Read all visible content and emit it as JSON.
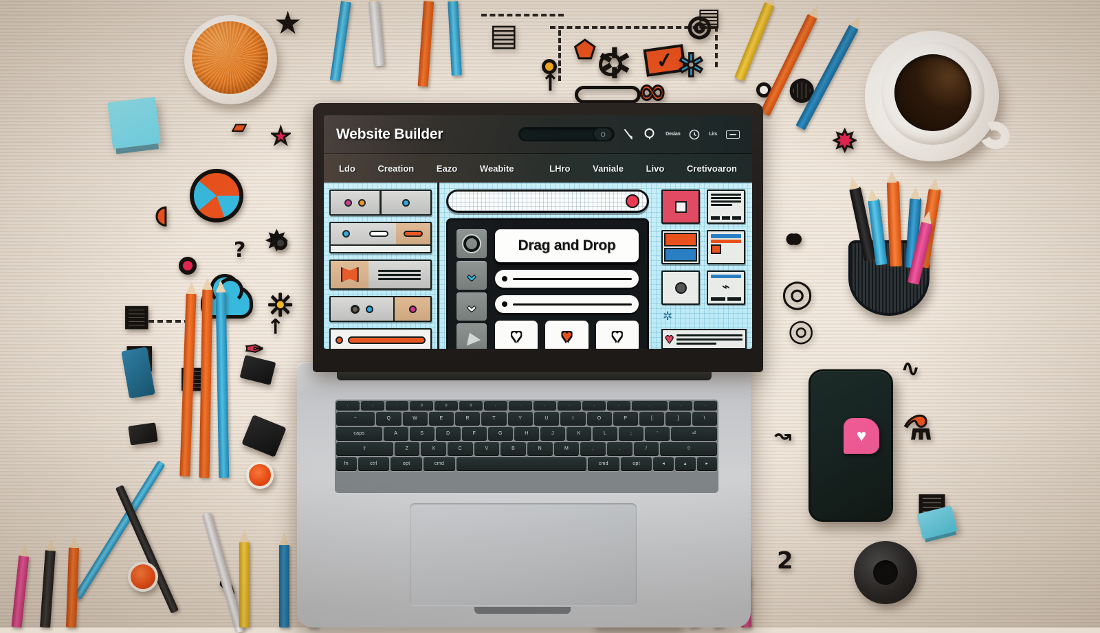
{
  "scene": {
    "description": "Top-down flat-lay of a laptop on a light wood desk running a website builder app, surrounded by colorful stationery and hand-drawn doodle stickers"
  },
  "app": {
    "title": "Website Builder",
    "urlbar": {
      "value": "",
      "knob_label": "O"
    },
    "header_icons": [
      {
        "name": "pen-tool-icon",
        "glyph": "\\"
      },
      {
        "name": "search-icon",
        "glyph": "Q"
      },
      {
        "name": "design-label",
        "text": "Desian"
      },
      {
        "name": "history-icon",
        "glyph": "◉"
      },
      {
        "name": "layers-label",
        "text": "Lirs"
      },
      {
        "name": "panel-button",
        "text": ""
      }
    ],
    "nav_items": [
      {
        "label": "Ldo"
      },
      {
        "label": "Creation"
      },
      {
        "label": "Eazo"
      },
      {
        "label": "Weabite"
      },
      {
        "label": "LHro"
      },
      {
        "label": "Vaniale"
      },
      {
        "label": "Livo"
      },
      {
        "label": "Cretivoaron"
      }
    ],
    "left_panel": {
      "name": "components-panel",
      "widgets": [
        {
          "name": "widget-three-dots",
          "type": "dots-split",
          "dots": [
            "#d0318f",
            "#f0911e",
            "#2aa5dd"
          ]
        },
        {
          "name": "widget-toolbar",
          "type": "toolbar",
          "dot": "#2aa5dd",
          "pill": "#ffffff",
          "pill2": "#e8531e"
        },
        {
          "name": "widget-media-text",
          "type": "media-text",
          "accent": "#e8531e"
        },
        {
          "name": "widget-avatars",
          "type": "avatars",
          "dots": [
            "#6b5a4a",
            "#2aa5dd",
            "#d0318f"
          ]
        },
        {
          "name": "widget-progress",
          "type": "progress",
          "fill": "#e8531e"
        }
      ]
    },
    "center_panel": {
      "name": "canvas",
      "browser_bar": {
        "record_dot_color": "#ea3b52"
      },
      "tools": [
        {
          "name": "ellipse-tool",
          "glyph": "◯"
        },
        {
          "name": "chevron-down-tool-blue",
          "glyph": "⌄"
        },
        {
          "name": "chevron-down-tool-white",
          "glyph": "⌄"
        },
        {
          "name": "cursor-tool",
          "glyph": "▲"
        }
      ],
      "dnd_label": "Drag and Drop",
      "fields": [
        {
          "name": "canvas-field-1",
          "value": ""
        },
        {
          "name": "canvas-field-2",
          "value": ""
        }
      ],
      "heart_buttons": [
        {
          "name": "heart-button-outline-left",
          "style": "outline"
        },
        {
          "name": "heart-button-filled",
          "style": "filled",
          "color": "#e8511d"
        },
        {
          "name": "heart-button-outline-right",
          "style": "outline"
        }
      ]
    },
    "right_panel": {
      "name": "templates-panel",
      "templates": [
        {
          "name": "template-pink-image"
        },
        {
          "name": "template-article"
        },
        {
          "name": "template-open-book"
        },
        {
          "name": "template-landing-page"
        },
        {
          "name": "template-photo-card"
        },
        {
          "name": "template-chart-card"
        },
        {
          "name": "template-gear-icon"
        },
        {
          "name": "template-favorite-card"
        }
      ]
    }
  },
  "keyboard": {
    "name": "laptop-keyboard",
    "rows": [
      [
        "·",
        "·",
        "·",
        "·",
        "0",
        "0",
        "0",
        "·",
        "·",
        "·",
        "·",
        "·",
        "·",
        "·",
        "·",
        "·",
        "·"
      ],
      [
        "~",
        "Q",
        "W",
        "E",
        "R",
        "T",
        "Y",
        "U",
        "I",
        "O",
        "P",
        "[",
        "]",
        "\\"
      ],
      [
        "caps",
        "A",
        "S",
        "D",
        "F",
        "G",
        "H",
        "J",
        "K",
        "L",
        ";",
        "'",
        "return"
      ],
      [
        "shift",
        "Z",
        "X",
        "C",
        "V",
        "B",
        "N",
        "M",
        ",",
        ".",
        "/",
        "shift"
      ],
      [
        "fn",
        "ctrl",
        "opt",
        "cmd",
        "",
        "cmd",
        "opt",
        "◂",
        "▴▾",
        "▸"
      ]
    ]
  },
  "desk_objects": [
    {
      "name": "yarn-ball-bowl",
      "color": "#f5821f"
    },
    {
      "name": "coffee-cup",
      "color": "#ffffff"
    },
    {
      "name": "smartphone",
      "app_icon_color": "#ef5a95"
    },
    {
      "name": "pencil-cup"
    },
    {
      "name": "grid-notepad"
    },
    {
      "name": "cyan-sticky-block",
      "color": "#6fd4e6"
    },
    {
      "name": "tape-roll"
    },
    {
      "name": "orange-paint-pot",
      "color": "#ea4a12"
    },
    {
      "name": "binder-clips"
    },
    {
      "name": "colored-pencils"
    }
  ],
  "doodles": [
    {
      "name": "beach-ball-doodle"
    },
    {
      "name": "cloud-doodle"
    },
    {
      "name": "gear-doodle"
    },
    {
      "name": "envelope-check-doodle"
    },
    {
      "name": "infinity-doodle"
    },
    {
      "name": "star-doodle"
    },
    {
      "name": "shield-doodle"
    },
    {
      "name": "capsule-doodle"
    },
    {
      "name": "target-doodle"
    },
    {
      "name": "sun-doodle"
    },
    {
      "name": "lightbulb-doodle"
    },
    {
      "name": "sunglasses-doodle"
    },
    {
      "name": "compass-doodle"
    },
    {
      "name": "spiral-doodle"
    },
    {
      "name": "notepad-doodle"
    },
    {
      "name": "heart-doodle"
    },
    {
      "name": "feather-doodle"
    },
    {
      "name": "flask-doodle"
    },
    {
      "name": "ruler-doodle"
    }
  ],
  "colors": {
    "desk": "#eadfd2",
    "orange": "#e8531e",
    "cyan": "#37b8dd",
    "pink": "#e04a63",
    "ink": "#14110f",
    "screen_canvas": "#b8e8f5"
  }
}
